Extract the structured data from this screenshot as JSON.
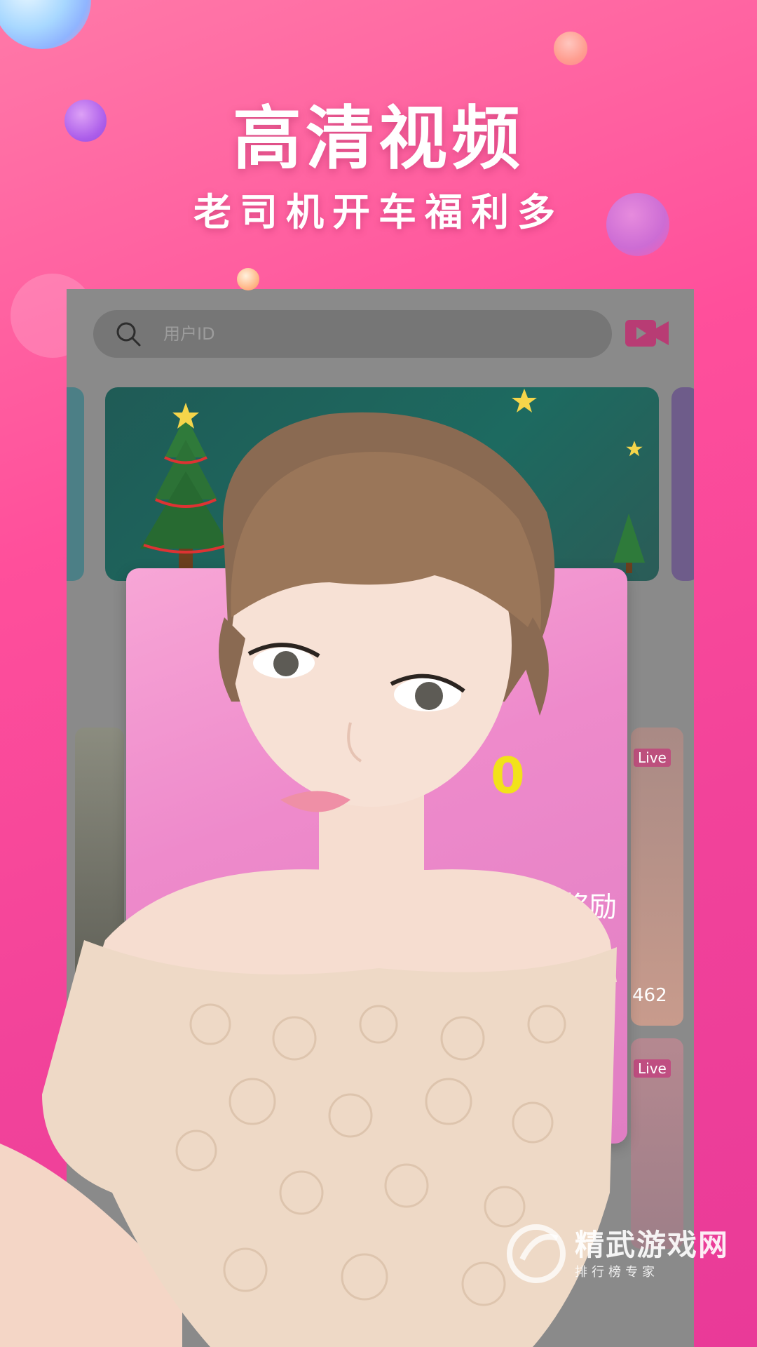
{
  "promo": {
    "headline": "高清视频",
    "subline": "老司机开车福利多"
  },
  "app": {
    "search": {
      "placeholder": "用户ID"
    },
    "live_tag": "Live",
    "viewer_count": "462",
    "popup": {
      "amount": "0",
      "reward_text": "奖励"
    }
  },
  "watermark": {
    "name": "精武游戏网",
    "tagline": "排行榜专家"
  },
  "colors": {
    "background_start": "#ff79a8",
    "background_end": "#e93a98",
    "accent": "#e0357f",
    "popup_pink": "#ee8acb",
    "amount_yellow": "#f2e21a"
  },
  "icons": [
    "search-icon",
    "video-camera-icon",
    "christmas-tree-icon",
    "star-icon",
    "logo-icon"
  ]
}
